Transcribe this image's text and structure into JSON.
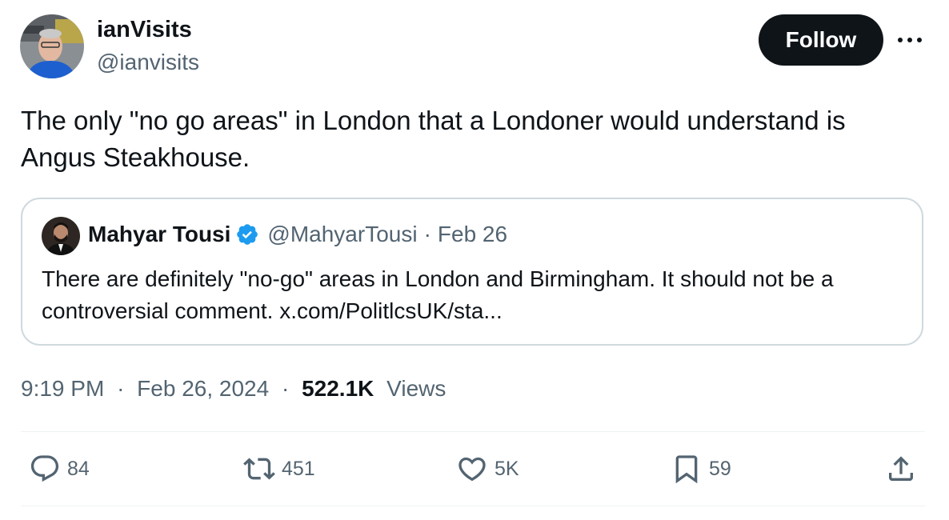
{
  "tweet": {
    "author_name": "ianVisits",
    "author_handle": "@ianvisits",
    "follow_label": "Follow",
    "text": "The only \"no go areas\" in London that a Londoner would understand is Angus Steakhouse.",
    "quote": {
      "author_name": "Mahyar Tousi",
      "author_handle": "@MahyarTousi",
      "separator": "·",
      "date": "Feb 26",
      "text": "There are definitely \"no-go\" areas in London and Birmingham. It should not be a controversial comment. x.com/PolitlcsUK/sta..."
    },
    "meta": {
      "time": "9:19 PM",
      "separator": "·",
      "date": "Feb 26, 2024",
      "views_count": "522.1K",
      "views_label": "Views"
    },
    "actions": {
      "replies": "84",
      "reposts": "451",
      "likes": "5K",
      "bookmarks": "59"
    }
  },
  "icons": {
    "more": "more-horizontal-icon",
    "verified": "verified-badge-icon",
    "reply": "reply-bubble-icon",
    "repost": "repost-arrows-icon",
    "like": "heart-icon",
    "bookmark": "bookmark-icon",
    "share": "share-upload-icon"
  },
  "colors": {
    "text_primary": "#0f1419",
    "text_secondary": "#536471",
    "border": "#cfd9de",
    "verified_blue": "#1d9bf0",
    "follow_bg": "#0f1419"
  }
}
